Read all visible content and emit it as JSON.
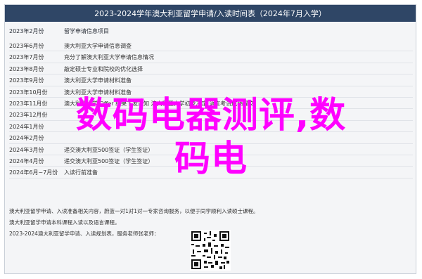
{
  "title": "2023-2024学年澳大利亚留学申请/入读时间表（2024年7月入学）",
  "table": {
    "headers": [
      "2023年2月份",
      "留学申请信息项目"
    ],
    "rows": [
      {
        "date": "2023年6月份",
        "task": "澳大利亚大学申请信息调查"
      },
      {
        "date": "2023年7月份",
        "task": "充分了解澳大利亚大学申请信息情况"
      },
      {
        "date": "2023年8月份",
        "task": "敲定硕士专业和院校的优化选择"
      },
      {
        "date": "2023年9月份",
        "task": "澳大利亚大学申请材料准备"
      },
      {
        "date": "2023年10月份",
        "task": "澳大利亚大学申请材料准备"
      },
      {
        "date": "2023年11月份",
        "task": "澳大利亚大学 Offer 结果下发通知     澳大利亚大学初步决定     语言考试成绩提交"
      },
      {
        "date": "2023年12月份",
        "task": ""
      },
      {
        "date": "2024年1月份",
        "task": ""
      },
      {
        "date": "2024年2月份",
        "task": ""
      },
      {
        "date": "2024年3月份",
        "task": "递交澳大利亚500签证（学生签证）"
      },
      {
        "date": "2024年4月份",
        "task": "递交澳大利亚500签证（学生签证）"
      },
      {
        "date": "2024年6月~7月份",
        "task": "入读行前准备"
      }
    ]
  },
  "footer": {
    "line1": "澳大利亚留学申请、入读准备相关内容，蔚蓝一对1对1对一专家咨询服务，以便于同学顺利入读硕士课程。",
    "line2": "澳大利亚留学申请本科课程入读以及语言课程。",
    "line3": "2023-2024澳大利亚留学申请、入读规划表，服务老师张老师："
  },
  "overlay": {
    "line1": "数码电器测评,数",
    "line2": "码电",
    "color": "#ff00ff"
  }
}
